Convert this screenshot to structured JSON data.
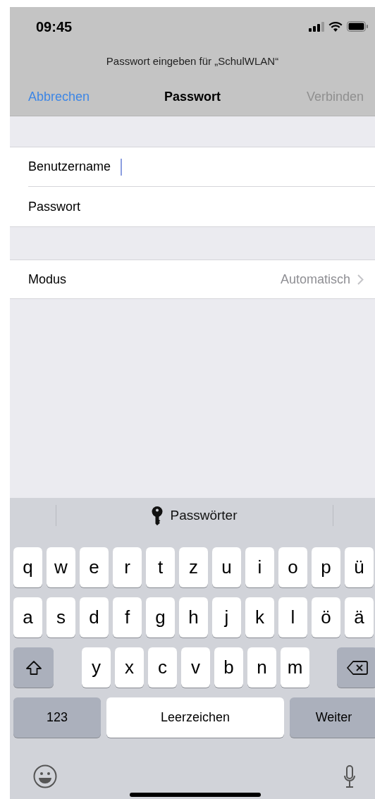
{
  "status_bar": {
    "time": "09:45"
  },
  "prompt": "Passwort eingeben für „SchulWLAN“",
  "nav": {
    "cancel": "Abbrechen",
    "title": "Passwort",
    "confirm": {
      "label": "Verbinden",
      "disabled": true
    }
  },
  "credentials": [
    {
      "label": "Benutzername",
      "focused": true
    },
    {
      "label": "Passwort",
      "focused": false
    }
  ],
  "settings": [
    {
      "label": "Modus",
      "value": "Automatisch"
    }
  ],
  "keyboard": {
    "suggestion": "Passwörter",
    "rows": [
      {
        "keys": [
          {
            "kind": "letter",
            "label": "q"
          },
          {
            "kind": "letter",
            "label": "w"
          },
          {
            "kind": "letter",
            "label": "e"
          },
          {
            "kind": "letter",
            "label": "r"
          },
          {
            "kind": "letter",
            "label": "t"
          },
          {
            "kind": "letter",
            "label": "z"
          },
          {
            "kind": "letter",
            "label": "u"
          },
          {
            "kind": "letter",
            "label": "i"
          },
          {
            "kind": "letter",
            "label": "o"
          },
          {
            "kind": "letter",
            "label": "p"
          },
          {
            "kind": "letter",
            "label": "ü"
          }
        ]
      },
      {
        "keys": [
          {
            "kind": "letter",
            "label": "a"
          },
          {
            "kind": "letter",
            "label": "s"
          },
          {
            "kind": "letter",
            "label": "d"
          },
          {
            "kind": "letter",
            "label": "f"
          },
          {
            "kind": "letter",
            "label": "g"
          },
          {
            "kind": "letter",
            "label": "h"
          },
          {
            "kind": "letter",
            "label": "j"
          },
          {
            "kind": "letter",
            "label": "k"
          },
          {
            "kind": "letter",
            "label": "l"
          },
          {
            "kind": "letter",
            "label": "ö"
          },
          {
            "kind": "letter",
            "label": "ä"
          }
        ]
      },
      {
        "keys": [
          {
            "kind": "shift"
          },
          {
            "kind": "letter",
            "label": "y"
          },
          {
            "kind": "letter",
            "label": "x"
          },
          {
            "kind": "letter",
            "label": "c"
          },
          {
            "kind": "letter",
            "label": "v"
          },
          {
            "kind": "letter",
            "label": "b"
          },
          {
            "kind": "letter",
            "label": "n"
          },
          {
            "kind": "letter",
            "label": "m"
          },
          {
            "kind": "delete"
          }
        ]
      },
      {
        "keys": [
          {
            "kind": "numbers",
            "label": "123"
          },
          {
            "kind": "space",
            "label": "Leerzeichen"
          },
          {
            "kind": "return",
            "label": "Weiter"
          }
        ]
      }
    ]
  }
}
